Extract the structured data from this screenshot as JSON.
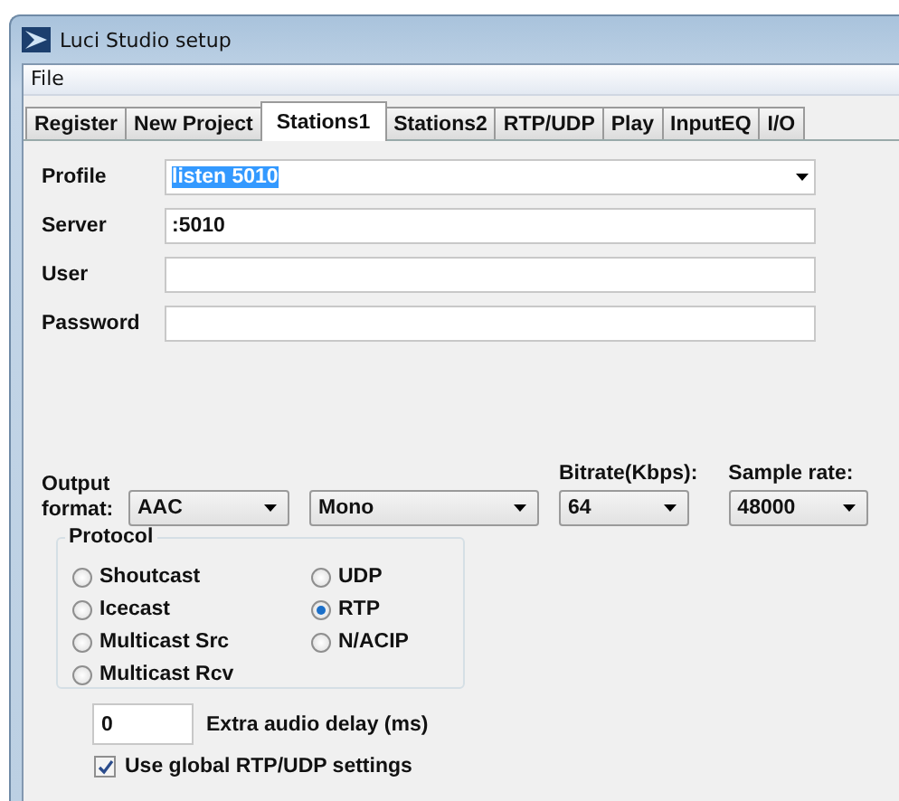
{
  "window": {
    "title": "Luci Studio setup"
  },
  "menu": [
    "File"
  ],
  "tabs": [
    {
      "label": "Register",
      "selected": false
    },
    {
      "label": "New Project",
      "selected": false
    },
    {
      "label": "Stations1",
      "selected": true
    },
    {
      "label": "Stations2",
      "selected": false
    },
    {
      "label": "RTP/UDP",
      "selected": false
    },
    {
      "label": "Play",
      "selected": false
    },
    {
      "label": "InputEQ",
      "selected": false
    },
    {
      "label": "I/O",
      "selected": false
    }
  ],
  "fields": [
    {
      "label": "Profile",
      "kind": "combo",
      "value": "listen 5010",
      "value_selected": true
    },
    {
      "label": "Server",
      "kind": "text",
      "value": ":5010",
      "value_selected": false
    },
    {
      "label": "User",
      "kind": "text"
    },
    {
      "label": "Password",
      "kind": "text"
    }
  ],
  "output": {
    "label": "Output format:",
    "bitrate_label": "Bitrate(Kbps):",
    "sample_rate_label": "Sample rate:",
    "combos": [
      {
        "value": "AAC"
      },
      {
        "value": "Mono"
      },
      {
        "value": "64"
      },
      {
        "value": "48000"
      }
    ]
  },
  "protocol": {
    "title": "Protocol",
    "options": [
      {
        "label": "Shoutcast",
        "selected": false
      },
      {
        "label": "Icecast",
        "selected": false
      },
      {
        "label": "Multicast Src",
        "selected": false
      },
      {
        "label": "Multicast Rcv",
        "selected": false
      },
      {
        "label": "UDP",
        "selected": false
      },
      {
        "label": "RTP",
        "selected": true
      },
      {
        "label": "N/ACIP",
        "selected": false
      }
    ]
  },
  "delay": {
    "value": "0",
    "label": "Extra audio delay (ms)"
  },
  "global_settings": {
    "label": "Use global RTP/UDP settings",
    "checked": true
  }
}
